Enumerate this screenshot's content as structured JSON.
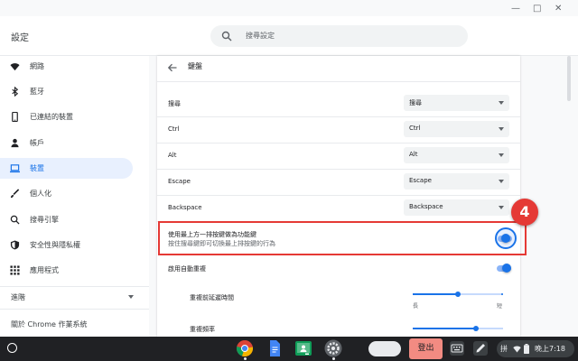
{
  "window": {
    "title": "設定",
    "controls": {
      "minimize": "—",
      "maximize": "□",
      "close": "✕"
    }
  },
  "search": {
    "placeholder": "搜尋設定",
    "icon": "search-icon"
  },
  "sidebar": {
    "items": [
      {
        "label": "網路",
        "icon": "wifi-icon",
        "active": false
      },
      {
        "label": "藍牙",
        "icon": "bluetooth-icon",
        "active": false
      },
      {
        "label": "已連結的裝置",
        "icon": "phone-icon",
        "active": false
      },
      {
        "label": "帳戶",
        "icon": "person-icon",
        "active": false
      },
      {
        "label": "裝置",
        "icon": "laptop-icon",
        "active": true
      },
      {
        "label": "個人化",
        "icon": "brush-icon",
        "active": false
      },
      {
        "label": "搜尋引擎",
        "icon": "search-icon",
        "active": false
      },
      {
        "label": "安全性與隱私權",
        "icon": "shield-icon",
        "active": false
      },
      {
        "label": "應用程式",
        "icon": "grid-icon",
        "active": false
      }
    ],
    "advanced": "進階",
    "about": "關於 Chrome 作業系統"
  },
  "main": {
    "title": "鍵盤",
    "rows": [
      {
        "label": "搜尋",
        "value": "搜尋"
      },
      {
        "label": "Ctrl",
        "value": "Ctrl"
      },
      {
        "label": "Alt",
        "value": "Alt"
      },
      {
        "label": "Escape",
        "value": "Escape"
      },
      {
        "label": "Backspace",
        "value": "Backspace"
      }
    ],
    "function_keys": {
      "label": "使用最上方一排按鍵做為功能鍵",
      "sublabel": "按住搜尋鍵即可切換最上排按鍵的行為",
      "enabled": true
    },
    "auto_repeat": {
      "label": "啟用自動重複",
      "enabled": true
    },
    "repeat_delay": {
      "label": "重複前延遲時間",
      "min_label": "長",
      "max_label": "短",
      "value_fraction": 0.5
    },
    "repeat_rate": {
      "label": "重複頻率",
      "value_fraction": 0.7
    }
  },
  "annotation": {
    "badge": "4",
    "color": "#e53935"
  },
  "shelf": {
    "apps": [
      "chrome-icon",
      "docs-icon",
      "classroom-icon",
      "settings-icon"
    ],
    "logout": "登出",
    "ime": "拼",
    "time": "晚上7:18"
  },
  "colors": {
    "accent": "#1a73e8",
    "active_bg": "#e8f0fe",
    "highlight": "#e53935",
    "logout": "#f28b82"
  }
}
